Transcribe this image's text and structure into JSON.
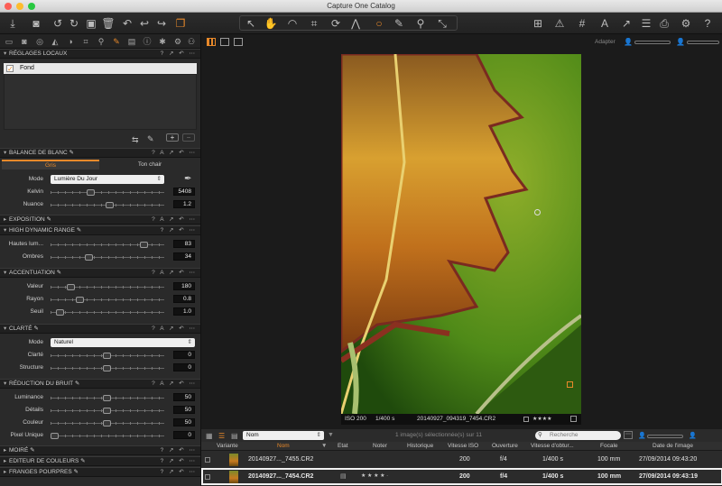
{
  "window": {
    "title": "Capture One Catalog"
  },
  "viewer": {
    "toolbar_label": "Adapter"
  },
  "left": {
    "local_adjustments": {
      "title": "RÉGLAGES LOCAUX",
      "layer": "Fond"
    },
    "white_balance": {
      "title": "BALANCE DE BLANC",
      "tab_grey": "Gris",
      "tab_skin": "Ton chair",
      "mode_label": "Mode",
      "mode_value": "Lumière Du Jour",
      "kelvin_label": "Kelvin",
      "kelvin_value": "5408",
      "tint_label": "Nuance",
      "tint_value": "1.2"
    },
    "exposure": {
      "title": "EXPOSITION"
    },
    "hdr": {
      "title": "HIGH DYNAMIC RANGE",
      "highlights_label": "Hautes lum...",
      "highlights_value": "83",
      "shadows_label": "Ombres",
      "shadows_value": "34"
    },
    "sharpening": {
      "title": "ACCENTUATION",
      "amount_label": "Valeur",
      "amount_value": "180",
      "radius_label": "Rayon",
      "radius_value": "0.8",
      "threshold_label": "Seuil",
      "threshold_value": "1.0"
    },
    "clarity": {
      "title": "CLARTÉ",
      "mode_label": "Mode",
      "mode_value": "Naturel",
      "clarity_label": "Clarté",
      "clarity_value": "0",
      "structure_label": "Structure",
      "structure_value": "0"
    },
    "noise": {
      "title": "RÉDUCTION DU BRUIT",
      "luminance_label": "Luminance",
      "luminance_value": "50",
      "details_label": "Détails",
      "details_value": "50",
      "color_label": "Couleur",
      "color_value": "50",
      "single_pixel_label": "Pixel Unique",
      "single_pixel_value": "0"
    },
    "moire": {
      "title": "MOIRÉ"
    },
    "color_editor": {
      "title": "EDITEUR DE COULEURS"
    },
    "purple_fringe": {
      "title": "FRANGES POURPRES"
    }
  },
  "image_info": {
    "iso": "ISO 200",
    "shutter": "1/400 s",
    "filename": "20140927_094319_7454.CR2",
    "stars": "★★★★"
  },
  "browser": {
    "sort_value": "Nom",
    "status": "1 image(s) sélectionnée(s) sur 11",
    "search_placeholder": "Recherche",
    "columns": [
      "Variante",
      "Nom",
      "Etat",
      "Noter",
      "Historique",
      "Vitesse ISO",
      "Ouverture",
      "Vitesse d'obtur...",
      "Focale",
      "Date de l'image"
    ],
    "rows": [
      {
        "name": "20140927..._7455.CR2",
        "rating": "",
        "iso": "200",
        "aperture": "f/4",
        "shutter": "1/400 s",
        "focal": "100 mm",
        "date": "27/09/2014 09:43:20"
      },
      {
        "name": "20140927..._7454.CR2",
        "rating": "★ ★ ★ ★ ·",
        "iso": "200",
        "aperture": "f/4",
        "shutter": "1/400 s",
        "focal": "100 mm",
        "date": "27/09/2014 09:43:19"
      }
    ]
  },
  "colors": {
    "accent": "#e8892a",
    "panel": "#2a2a2a"
  }
}
